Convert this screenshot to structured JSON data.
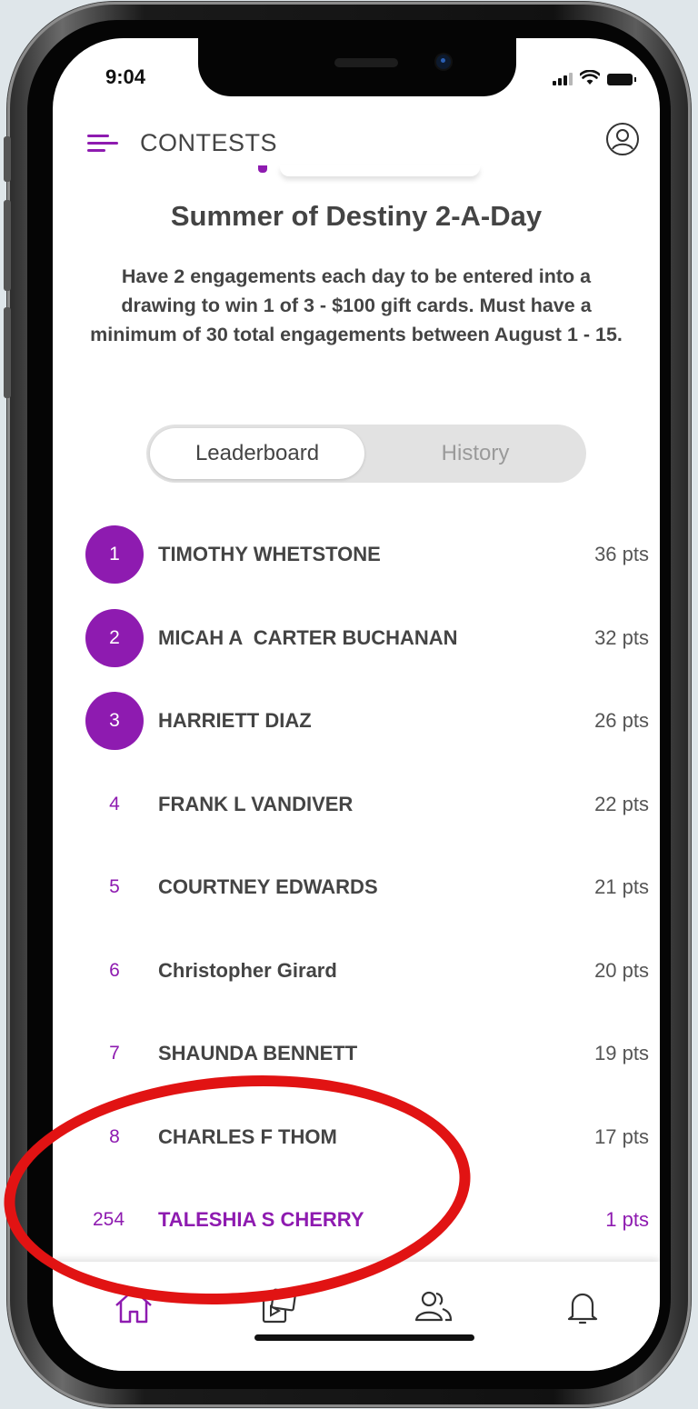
{
  "status_bar": {
    "time": "9:04"
  },
  "header": {
    "title": "CONTESTS"
  },
  "contest": {
    "title": "Summer of Destiny 2-A-Day",
    "description": "Have 2 engagements each day to be entered into a drawing to win 1 of 3 - $100 gift cards. Must have a minimum of 30 total engagements between August 1 - 15."
  },
  "tabs": {
    "leaderboard": "Leaderboard",
    "history": "History",
    "active": "leaderboard"
  },
  "leaderboard": [
    {
      "rank": "1",
      "name": "TIMOTHY WHETSTONE",
      "points": "36 pts"
    },
    {
      "rank": "2",
      "name": "MICAH A  CARTER BUCHANAN",
      "points": "32 pts"
    },
    {
      "rank": "3",
      "name": "HARRIETT DIAZ",
      "points": "26 pts"
    },
    {
      "rank": "4",
      "name": "FRANK L VANDIVER",
      "points": "22 pts"
    },
    {
      "rank": "5",
      "name": "COURTNEY EDWARDS",
      "points": "21 pts"
    },
    {
      "rank": "6",
      "name": "Christopher Girard",
      "points": "20 pts"
    },
    {
      "rank": "7",
      "name": "SHAUNDA BENNETT",
      "points": "19 pts"
    },
    {
      "rank": "8",
      "name": "CHARLES F THOM",
      "points": "17 pts"
    }
  ],
  "current_user": {
    "rank": "254",
    "name": "TALESHIA S CHERRY",
    "points": "1 pts"
  },
  "bottom_nav": {
    "items": [
      "home-icon",
      "media-icon",
      "people-icon",
      "bell-icon"
    ],
    "active": "home-icon"
  },
  "colors": {
    "accent": "#8e1bb0",
    "annotation": "#e11313"
  }
}
